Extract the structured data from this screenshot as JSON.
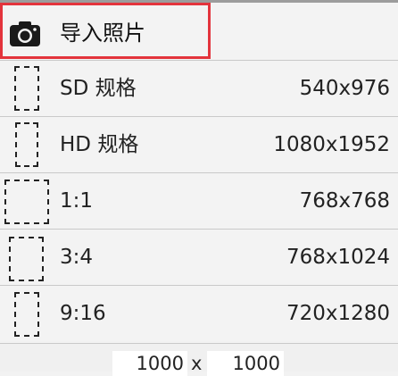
{
  "import": {
    "label": "导入照片"
  },
  "options": [
    {
      "label": "SD 规格",
      "value": "540x976"
    },
    {
      "label": "HD 规格",
      "value": "1080x1952"
    },
    {
      "label": "1:1",
      "value": "768x768"
    },
    {
      "label": "3:4",
      "value": "768x1024"
    },
    {
      "label": "9:16",
      "value": "720x1280"
    }
  ],
  "custom_size": {
    "width": "1000",
    "separator": "x",
    "height": "1000"
  },
  "colors": {
    "highlight": "#e3343c",
    "divider": "#c9c9c9",
    "background": "#f3f3f3"
  }
}
